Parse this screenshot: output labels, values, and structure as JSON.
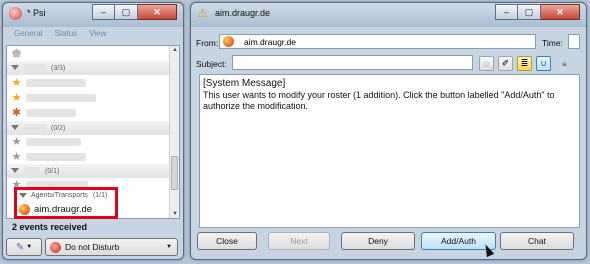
{
  "psi": {
    "title": "* Psi",
    "menu": [
      "General",
      "Status",
      "View"
    ],
    "groups": [
      {
        "count": "(3/3)"
      },
      {
        "count": "(0/2)"
      },
      {
        "count": "(0/1)"
      }
    ],
    "agents_group": {
      "label": "Agents/Transports",
      "count": "(1/1)"
    },
    "agent_contact": "aim.draugr.de",
    "status_text": "2 events received",
    "presence": "Do not Disturb"
  },
  "chat": {
    "title": "aim.draugr.de",
    "from_label": "From:",
    "from_value": "aim.draugr.de",
    "time_label": "Time:",
    "subject_label": "Subject:",
    "subject_value": "",
    "message_header": "[System Message]",
    "message_body": "This user wants to modify your roster (1 addition). Click the button labelled \"Add/Auth\" to authorize the modification.",
    "buttons": {
      "close": "Close",
      "next": "Next",
      "deny": "Deny",
      "add_auth": "Add/Auth",
      "chat": "Chat"
    }
  },
  "colors": {
    "highlight": "#e0001b",
    "accent": "#3c7fb1"
  }
}
